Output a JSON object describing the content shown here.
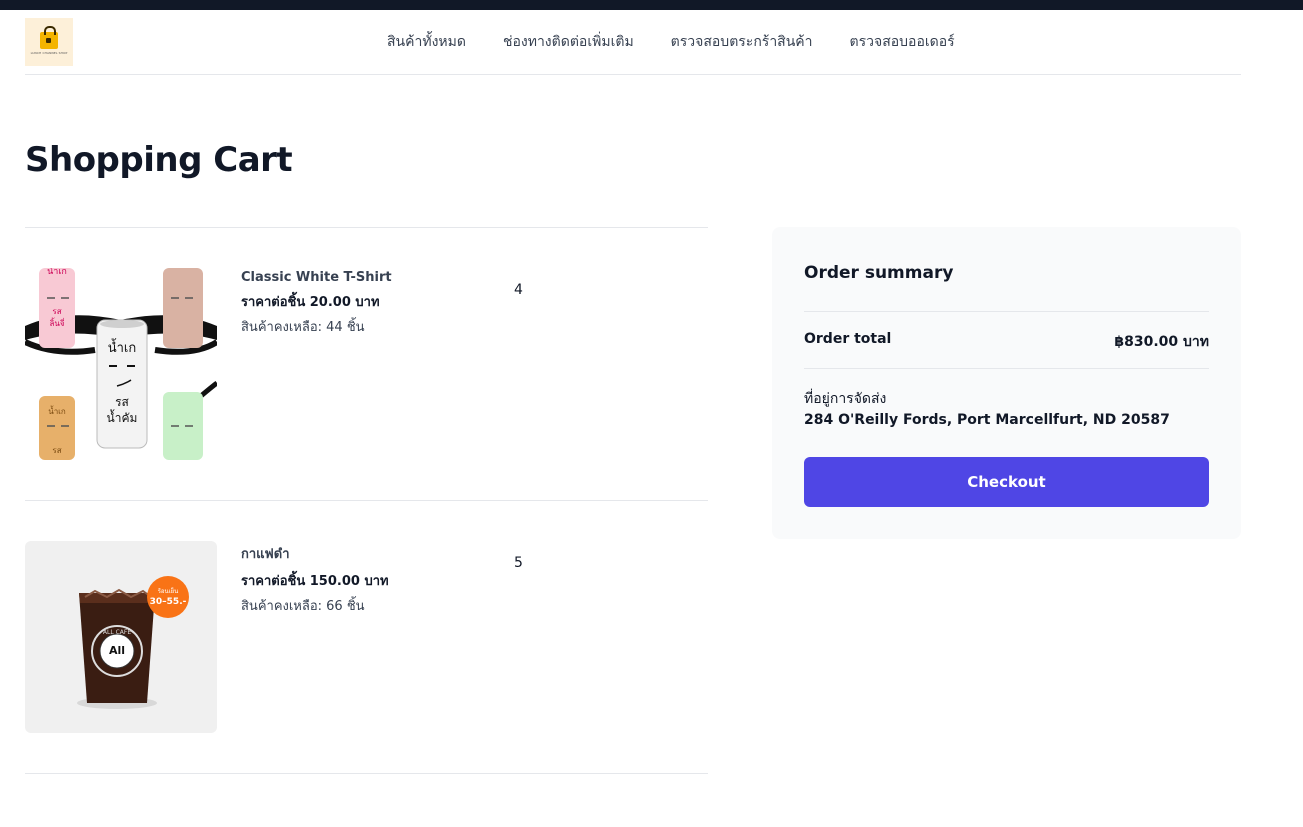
{
  "header": {
    "logo_text": "LUNCH CHANNEL SHOP",
    "nav": [
      {
        "label": "สินค้าทั้งหมด"
      },
      {
        "label": "ช่องทางติดต่อเพิ่มเติม"
      },
      {
        "label": "ตรวจสอบตระกร้าสินค้า"
      },
      {
        "label": "ตรวจสอบออเดอร์"
      }
    ]
  },
  "page": {
    "title": "Shopping Cart"
  },
  "cart": {
    "items": [
      {
        "name": "Classic White T-Shirt",
        "price": "ราคาต่อชิ้น 20.00 บาท",
        "stock": "สินค้าคงเหลือ: 44 ชิ้น",
        "quantity": "4",
        "image_icon": "cans-product-image",
        "can_labels": [
          "น้ำเก",
          "รส",
          "ลิ้นจี่",
          "น้ำเก",
          "รส",
          "น้ำคัม",
          "น้ำเก",
          "รส"
        ]
      },
      {
        "name": "กาแฟดำ",
        "price": "ราคาต่อชิ้น 150.00 บาท",
        "stock": "สินค้าคงเหลือ: 66 ชิ้น",
        "quantity": "5",
        "image_icon": "iced-coffee-image",
        "badge_line1": "ร้อนเย็น",
        "badge_line2": "30–55.-",
        "cup_brand": "All",
        "cup_ring": "ALL CAFE"
      }
    ]
  },
  "summary": {
    "title": "Order summary",
    "total_label": "Order total",
    "total_value": "฿830.00 บาท",
    "address_label": "ที่อยู่การจัดส่ง",
    "address_value": "284 O'Reilly Fords, Port Marcellfurt, ND 20587",
    "checkout_label": "Checkout"
  },
  "colors": {
    "accent": "#4f46e5",
    "topbar": "#111827",
    "summary_bg": "#f9fafb",
    "divider": "#e5e7eb",
    "badge": "#f97316"
  }
}
